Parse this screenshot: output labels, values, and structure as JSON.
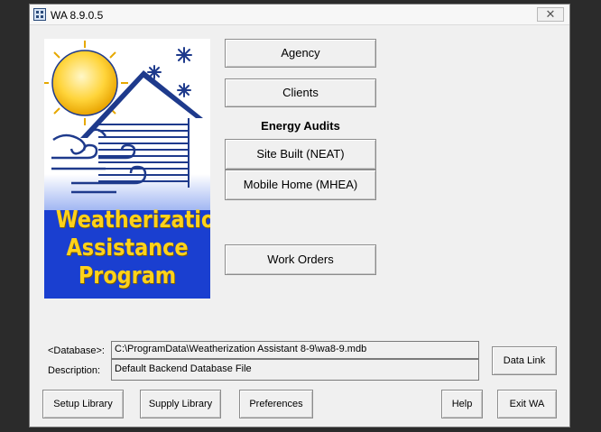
{
  "window": {
    "title": "WA 8.9.0.5",
    "close_glyph": "✕"
  },
  "logo": {
    "line1": "Weatherization",
    "line2": "Assistance",
    "line3": "Program"
  },
  "main_buttons": {
    "agency": "Agency",
    "clients": "Clients",
    "energy_audits_label": "Energy Audits",
    "site_built": "Site Built (NEAT)",
    "mobile_home": "Mobile Home (MHEA)",
    "work_orders": "Work Orders"
  },
  "database": {
    "database_label": "<Database>:",
    "database_value": "C:\\ProgramData\\Weatherization Assistant 8-9\\wa8-9.mdb",
    "description_label": "Description:",
    "description_value": "Default Backend Database File",
    "data_link": "Data Link"
  },
  "bottom_buttons": {
    "setup_library": "Setup Library",
    "supply_library": "Supply Library",
    "preferences": "Preferences",
    "help": "Help",
    "exit": "Exit WA"
  },
  "colors": {
    "logo_blue": "#1a3fd0",
    "logo_yellow": "#ffd21a",
    "logo_navy": "#1e3a8c"
  }
}
